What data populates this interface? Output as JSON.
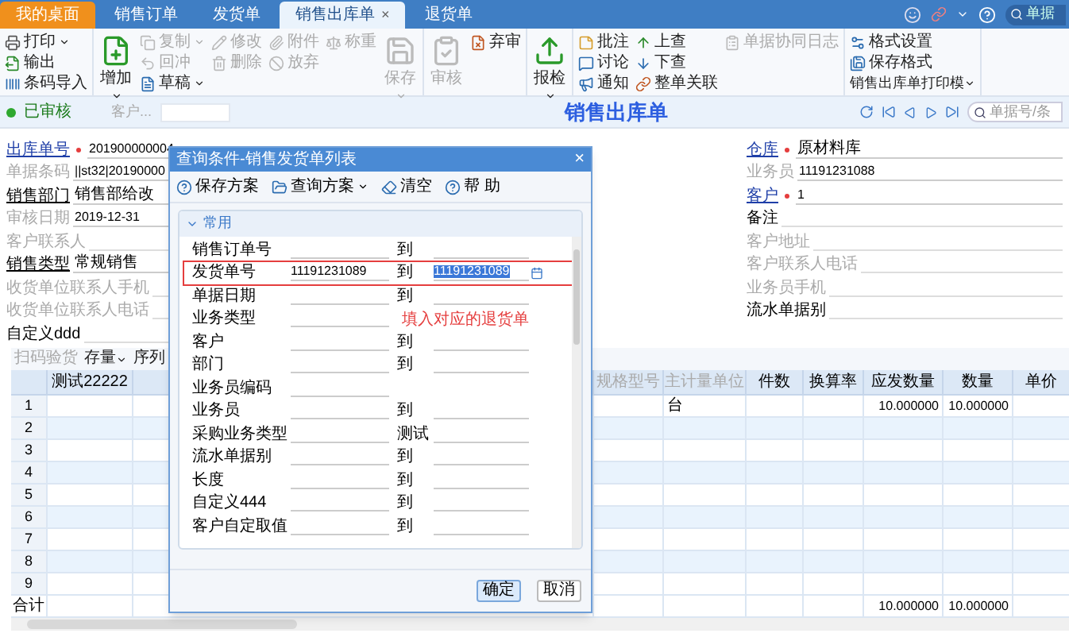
{
  "tabs": [
    {
      "label": "我的桌面",
      "kind": "home",
      "selected": false
    },
    {
      "label": "销售订单",
      "kind": "doc",
      "selected": false
    },
    {
      "label": "发货单",
      "kind": "doc",
      "selected": false
    },
    {
      "label": "销售出库单",
      "kind": "doc",
      "selected": true,
      "close": "×"
    },
    {
      "label": "退货单",
      "kind": "doc",
      "selected": false
    }
  ],
  "top_search": {
    "placeholder": "单据"
  },
  "toolbar": [
    {
      "columns": [
        [
          {
            "label": "打印",
            "kind": "small",
            "disabled": false,
            "dropdown": true
          },
          {
            "label": "输出",
            "kind": "small",
            "disabled": false,
            "dropdown": false
          },
          {
            "label": "条码导入",
            "kind": "small",
            "disabled": false,
            "dropdown": false
          }
        ]
      ]
    },
    {
      "columns": [
        [
          {
            "label": "增加",
            "kind": "large",
            "disabled": false,
            "dropdown": true
          }
        ],
        [
          {
            "label": "复制",
            "kind": "small",
            "disabled": true,
            "dropdown": true
          },
          {
            "label": "回冲",
            "kind": "small",
            "disabled": true,
            "dropdown": false
          },
          {
            "label": "草稿",
            "kind": "small",
            "disabled": false,
            "dropdown": true
          }
        ],
        [
          {
            "label": "修改",
            "kind": "small",
            "disabled": true,
            "dropdown": false
          },
          {
            "label": "删除",
            "kind": "small",
            "disabled": true,
            "dropdown": false
          }
        ],
        [
          {
            "label": "附件",
            "kind": "small",
            "disabled": true,
            "dropdown": false
          },
          {
            "label": "放弃",
            "kind": "small",
            "disabled": true,
            "dropdown": false
          }
        ],
        [
          {
            "label": "称重",
            "kind": "small",
            "disabled": true,
            "dropdown": false
          }
        ],
        [
          {
            "label": "保存",
            "kind": "large",
            "disabled": true,
            "dropdown": true
          }
        ]
      ]
    },
    {
      "columns": [
        [
          {
            "label": "审核",
            "kind": "large",
            "disabled": true,
            "dropdown": false
          }
        ],
        [
          {
            "label": "弃审",
            "kind": "small",
            "disabled": false,
            "dropdown": false
          }
        ]
      ]
    },
    {
      "columns": [
        [
          {
            "label": "报检",
            "kind": "large",
            "disabled": false,
            "dropdown": true
          }
        ]
      ]
    },
    {
      "columns": [
        [
          {
            "label": "批注",
            "kind": "small",
            "disabled": false,
            "dropdown": false
          },
          {
            "label": "讨论",
            "kind": "small",
            "disabled": false,
            "dropdown": false
          },
          {
            "label": "通知",
            "kind": "small",
            "disabled": false,
            "dropdown": false
          }
        ],
        [
          {
            "label": "上查",
            "kind": "small",
            "disabled": false,
            "dropdown": false
          },
          {
            "label": "下查",
            "kind": "small",
            "disabled": false,
            "dropdown": false
          },
          {
            "label": "整单关联",
            "kind": "small",
            "disabled": false,
            "dropdown": false
          }
        ],
        [
          {
            "label": "单据协同日志",
            "kind": "small",
            "disabled": true,
            "dropdown": false
          }
        ]
      ]
    },
    {
      "columns": [
        [
          {
            "label": "格式设置",
            "kind": "small",
            "disabled": false,
            "dropdown": false
          },
          {
            "label": "保存格式",
            "kind": "small",
            "disabled": false,
            "dropdown": false
          },
          {
            "label": "销售出库单打印模",
            "kind": "menu",
            "disabled": false,
            "dropdown": true
          }
        ]
      ]
    }
  ],
  "status": {
    "label": "已审核",
    "customer_placeholder": "客户...",
    "title": "销售出库单",
    "search_placeholder": "单据号/条"
  },
  "form_left": [
    {
      "label": "出库单号",
      "kind": "link",
      "required": true,
      "value": "201900000004"
    },
    {
      "label": "单据条码",
      "kind": "muted",
      "required": false,
      "value": "||st32|20190000"
    },
    {
      "label": "销售部门",
      "kind": "bold",
      "required": false,
      "value": "销售部给改"
    },
    {
      "label": "审核日期",
      "kind": "muted",
      "required": false,
      "value": "2019-12-31"
    },
    {
      "label": "客户联系人",
      "kind": "muted",
      "required": false
    },
    {
      "label": "销售类型",
      "kind": "bold",
      "required": false,
      "value": "常规销售"
    },
    {
      "label": "收货单位联系人手机",
      "kind": "muted",
      "required": false
    },
    {
      "label": "收货单位联系人电话",
      "kind": "muted",
      "required": false
    },
    {
      "label": "自定义ddd",
      "kind": "plain",
      "required": false
    }
  ],
  "form_right": [
    {
      "label": "仓库",
      "kind": "link",
      "required": true,
      "value": "原材料库"
    },
    {
      "label": "业务员",
      "kind": "muted",
      "required": false,
      "value": "11191231088"
    },
    {
      "label": "客户",
      "kind": "link",
      "required": true,
      "value": "1"
    },
    {
      "label": "备注",
      "kind": "plain",
      "required": false
    },
    {
      "label": "客户地址",
      "kind": "muted",
      "required": false
    },
    {
      "label": "客户联系人电话",
      "kind": "muted",
      "required": false
    },
    {
      "label": "业务员手机",
      "kind": "muted",
      "required": false
    },
    {
      "label": "流水单据别",
      "kind": "plain",
      "required": false
    }
  ],
  "grid_toolbar": [
    {
      "label": "扫码验货",
      "disabled": true,
      "dropdown": false
    },
    {
      "label": "存量",
      "disabled": false,
      "dropdown": true
    },
    {
      "label": "序列",
      "disabled": false,
      "dropdown": false
    }
  ],
  "grid": {
    "left_columns": [
      "测试22222"
    ],
    "right_columns": [
      {
        "label": "规格型号",
        "muted": true
      },
      {
        "label": "主计量单位",
        "muted": true
      },
      {
        "label": "件数",
        "muted": false
      },
      {
        "label": "换算率",
        "muted": false
      },
      {
        "label": "应发数量",
        "muted": false
      },
      {
        "label": "数量",
        "muted": false
      },
      {
        "label": "单价",
        "muted": false
      }
    ],
    "rows": [
      {
        "number": "1",
        "cells": {
          "1": "台",
          "4": "10.000000",
          "5": "10.000000"
        }
      },
      {
        "number": "2",
        "cells": {}
      },
      {
        "number": "3",
        "cells": {}
      },
      {
        "number": "4",
        "cells": {}
      },
      {
        "number": "5",
        "cells": {}
      },
      {
        "number": "6",
        "cells": {}
      },
      {
        "number": "7",
        "cells": {}
      },
      {
        "number": "8",
        "cells": {}
      },
      {
        "number": "9",
        "cells": {}
      }
    ],
    "total": {
      "label": "合计",
      "cells": {
        "4": "10.000000",
        "5": "10.000000"
      }
    }
  },
  "dialog": {
    "title": "查询条件-销售发货单列表",
    "close": "×",
    "toolbar": [
      {
        "label": "保存方案",
        "dropdown": false
      },
      {
        "label": "查询方案",
        "dropdown": true
      },
      {
        "label": "清空",
        "dropdown": false
      },
      {
        "label": "帮 助",
        "dropdown": false
      }
    ],
    "section": {
      "label": "常用",
      "expanded": true
    },
    "rows": [
      {
        "label": "销售订单号",
        "to_label": "到",
        "highlighted": false
      },
      {
        "label": "发货单号",
        "from": "11191231089",
        "to_label": "到",
        "to": "11191231089",
        "highlighted": true
      },
      {
        "label": "单据日期",
        "to_label": "到",
        "highlighted": false
      },
      {
        "label": "业务类型",
        "highlighted": false
      },
      {
        "label": "客户",
        "to_label": "到",
        "highlighted": false
      },
      {
        "label": "部门",
        "to_label": "到",
        "highlighted": false
      },
      {
        "label": "业务员编码",
        "highlighted": false
      },
      {
        "label": "业务员",
        "to_label": "到",
        "highlighted": false
      },
      {
        "label": "采购业务类型",
        "to_label": "测试",
        "highlighted": false
      },
      {
        "label": "流水单据别",
        "to_label": "到",
        "highlighted": false
      },
      {
        "label": "长度",
        "to_label": "到",
        "highlighted": false
      },
      {
        "label": "自定义444",
        "to_label": "到",
        "highlighted": false
      },
      {
        "label": "客户自定取值",
        "to_label": "到",
        "highlighted": false
      }
    ],
    "annotation": "填入对应的退货单",
    "buttons": [
      {
        "label": "确定",
        "kind": "primary"
      },
      {
        "label": "取消",
        "kind": "normal"
      }
    ]
  }
}
